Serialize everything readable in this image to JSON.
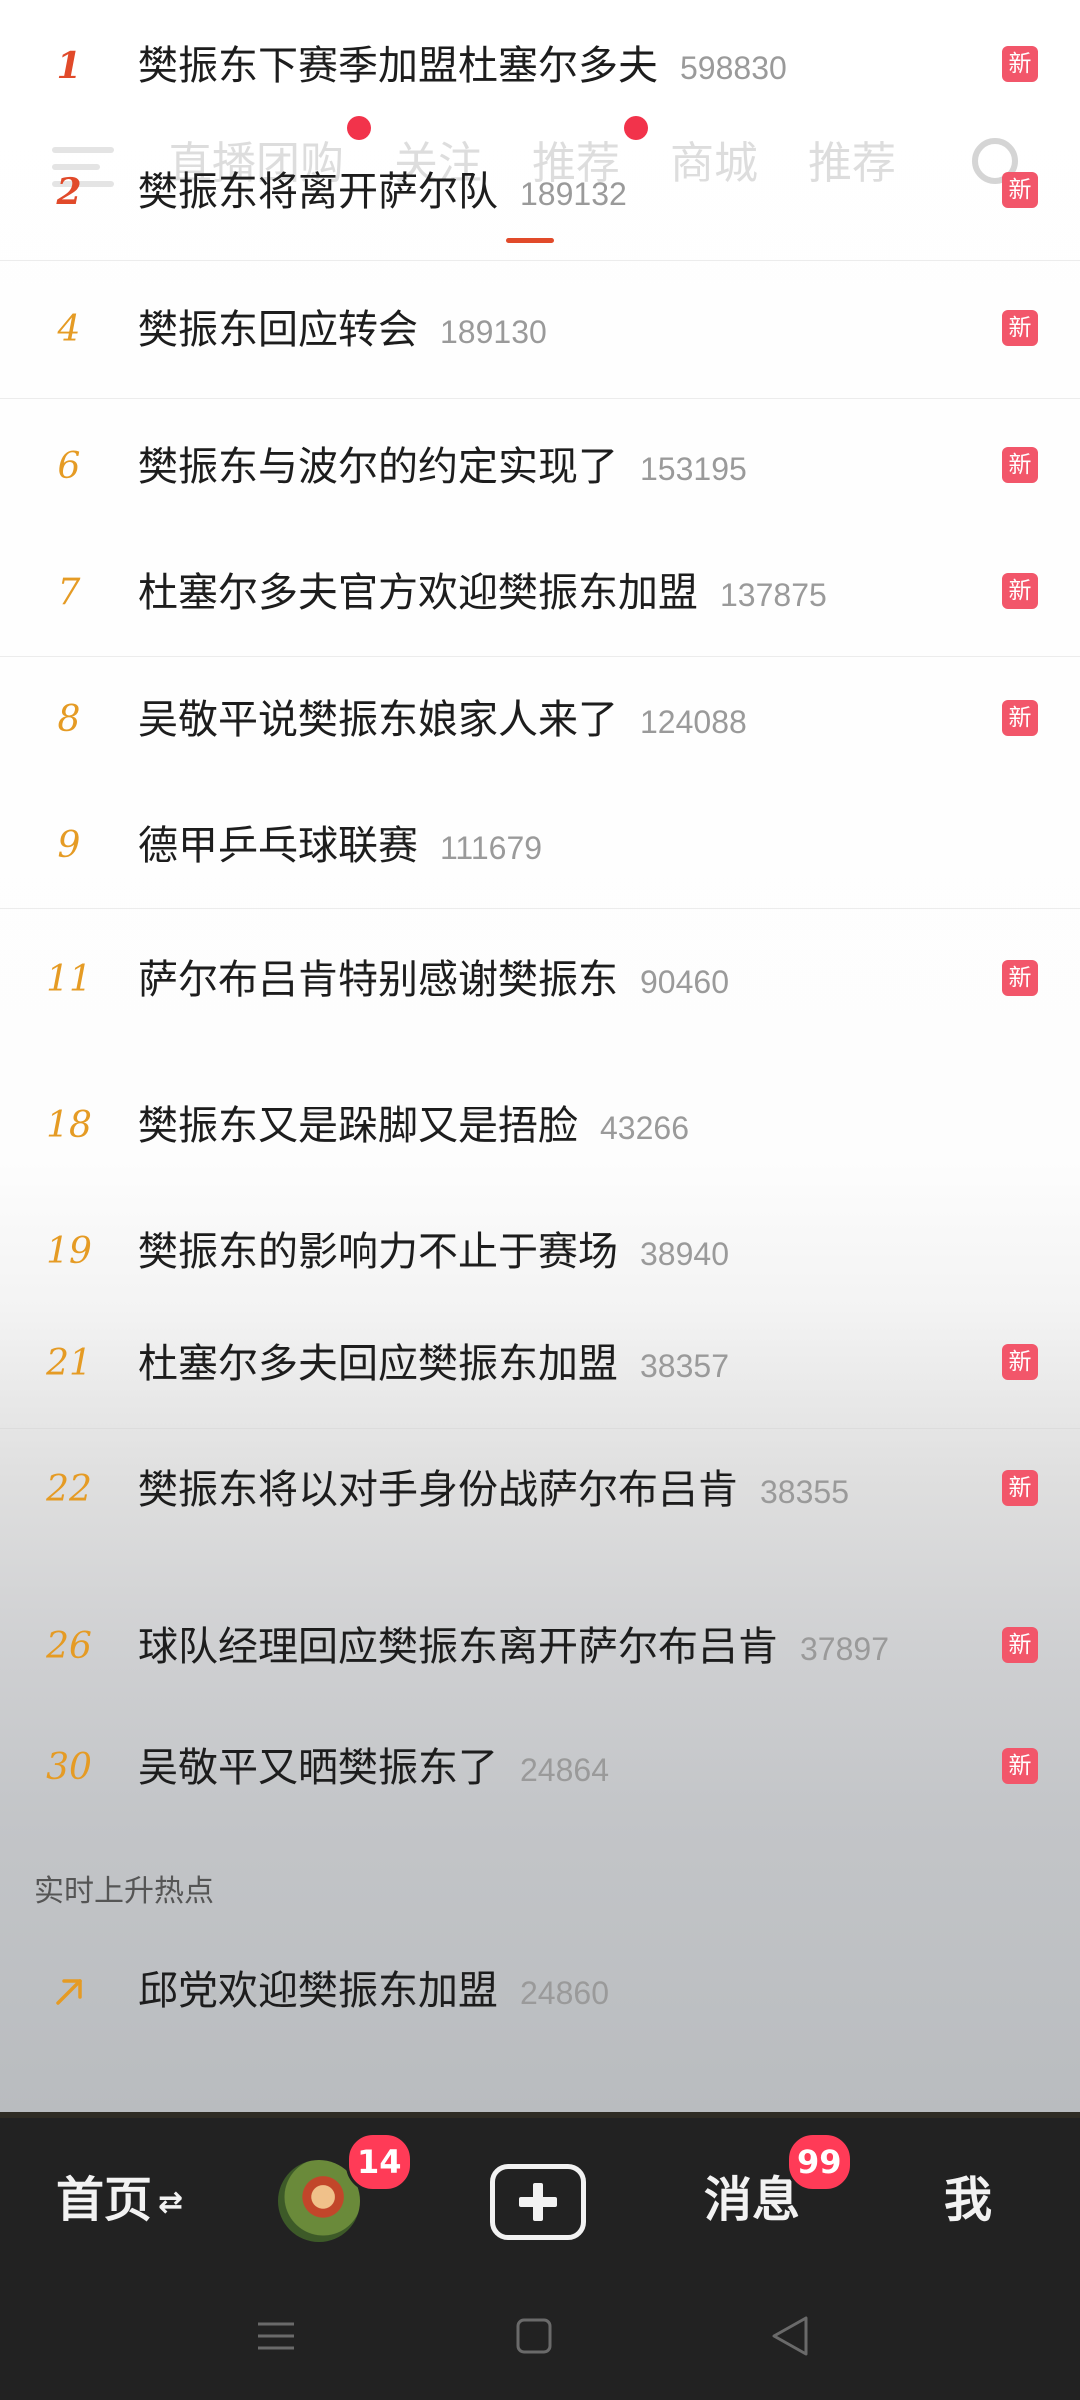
{
  "hot_list": [
    {
      "rank": "1",
      "title": "樊振东下赛季加盟杜塞尔多夫",
      "count": "598830",
      "badge": "新"
    },
    {
      "rank": "2",
      "title": "樊振东将离开萨尔队",
      "count": "189132",
      "badge": "新"
    },
    {
      "rank": "4",
      "title": "樊振东回应转会",
      "count": "189130",
      "badge": "新"
    },
    {
      "rank": "6",
      "title": "樊振东与波尔的约定实现了",
      "count": "153195",
      "badge": "新"
    },
    {
      "rank": "7",
      "title": "杜塞尔多夫官方欢迎樊振东加盟",
      "count": "137875",
      "badge": "新"
    },
    {
      "rank": "8",
      "title": "吴敬平说樊振东娘家人来了",
      "count": "124088",
      "badge": "新"
    },
    {
      "rank": "9",
      "title": "德甲乒乓球联赛",
      "count": "111679",
      "badge": ""
    },
    {
      "rank": "11",
      "title": "萨尔布吕肯特别感谢樊振东",
      "count": "90460",
      "badge": "新"
    },
    {
      "rank": "18",
      "title": "樊振东又是跺脚又是捂脸",
      "count": "43266",
      "badge": ""
    },
    {
      "rank": "19",
      "title": "樊振东的影响力不止于赛场",
      "count": "38940",
      "badge": ""
    },
    {
      "rank": "21",
      "title": "杜塞尔多夫回应樊振东加盟",
      "count": "38357",
      "badge": "新"
    },
    {
      "rank": "22",
      "title": "樊振东将以对手身份战萨尔布吕肯",
      "count": "38355",
      "badge": "新"
    },
    {
      "rank": "26",
      "title": "球队经理回应樊振东离开萨尔布吕肯",
      "count": "37897",
      "badge": "新"
    },
    {
      "rank": "30",
      "title": "吴敬平又晒樊振东了",
      "count": "24864",
      "badge": "新"
    }
  ],
  "rising": {
    "section_label": "实时上升热点",
    "items": [
      {
        "icon": "arrow-up-right-icon",
        "title": "邱党欢迎樊振东加盟",
        "count": "24860"
      }
    ]
  },
  "top_nav": {
    "tabs": [
      "直播",
      "团购",
      "关注",
      "推荐",
      "商城",
      "推荐"
    ],
    "dot_color": "#f2334b",
    "icons": [
      "menu-icon",
      "search-icon"
    ]
  },
  "tab_bar": {
    "home": "首页",
    "home_indicator": "⇄",
    "avatar_badge": "14",
    "messages": "消息",
    "messages_badge": "99",
    "me": "我",
    "post_icon": "plus-square-icon"
  },
  "colors": {
    "rank_top": "#e14a2a",
    "rank": "#e59b24",
    "badge": "#f2566a",
    "tab_badge": "#ff3b57"
  }
}
